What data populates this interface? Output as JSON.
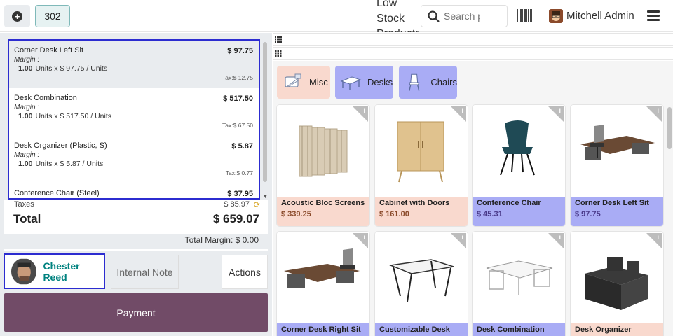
{
  "topbar": {
    "order_number": "302",
    "low_stock_label": "Low Stock Products",
    "search_placeholder": "Search products...",
    "user_name": "Mitchell Admin"
  },
  "orderlines": [
    {
      "name": "Corner Desk Left Sit",
      "price": "$ 97.75",
      "margin": "Margin :",
      "qty": "1.00",
      "unit_text": "Units x $ 97.75 / Units",
      "tax": "Tax:$ 12.75",
      "selected": true
    },
    {
      "name": "Desk Combination",
      "price": "$ 517.50",
      "margin": "Margin :",
      "qty": "1.00",
      "unit_text": "Units x $ 517.50 / Units",
      "tax": "Tax:$ 67.50",
      "selected": false
    },
    {
      "name": "Desk Organizer (Plastic, S)",
      "price": "$ 5.87",
      "margin": "Margin :",
      "qty": "1.00",
      "unit_text": "Units x $ 5.87 / Units",
      "tax": "Tax:$ 0.77",
      "selected": false
    },
    {
      "name": "Conference Chair (Steel)",
      "price": "$ 37.95",
      "margin": "",
      "qty": "",
      "unit_text": "",
      "tax": "",
      "selected": false
    }
  ],
  "summary": {
    "taxes_label": "Taxes",
    "taxes_value": "$ 85.97",
    "total_label": "Total",
    "total_value": "$ 659.07",
    "total_margin": "Total Margin: $ 0.00"
  },
  "actions": {
    "customer_name": "Chester Reed",
    "internal_note_label": "Internal Note",
    "actions_label": "Actions",
    "payment_label": "Payment"
  },
  "categories": [
    {
      "label": "Misc",
      "color": "#f9d9ce"
    },
    {
      "label": "Desks",
      "color": "#a9acf5"
    },
    {
      "label": "Chairs",
      "color": "#a9acf5"
    }
  ],
  "products": [
    {
      "name": "Acoustic Bloc Screens",
      "price": "$ 339.25",
      "category": "misc",
      "icon": "screens-image"
    },
    {
      "name": "Cabinet with Doors",
      "price": "$ 161.00",
      "category": "misc",
      "icon": "cabinet-image"
    },
    {
      "name": "Conference Chair",
      "price": "$ 45.31",
      "category": "desk",
      "icon": "chair-image"
    },
    {
      "name": "Corner Desk Left Sit",
      "price": "$ 97.75",
      "category": "desk",
      "icon": "corner-desk-image"
    },
    {
      "name": "Corner Desk Right Sit",
      "price": "",
      "category": "desk",
      "icon": "corner-desk-right-image"
    },
    {
      "name": "Customizable Desk",
      "price": "",
      "category": "desk",
      "icon": "custom-desk-image"
    },
    {
      "name": "Desk Combination",
      "price": "",
      "category": "desk",
      "icon": "desk-combination-image"
    },
    {
      "name": "Desk Organizer",
      "price": "",
      "category": "misc",
      "icon": "organizer-image"
    }
  ],
  "colors": {
    "accent": "#714b67",
    "customer": "#00827f",
    "selection": "#2c2cd0"
  }
}
